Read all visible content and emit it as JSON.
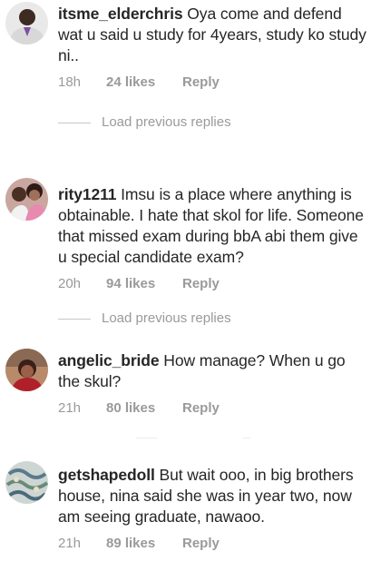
{
  "comments": [
    {
      "username": "itsme_elderchris",
      "text": "Oya come and defend wat u said u study for 4years, study ko study ni..",
      "time": "18h",
      "likes": "24 likes",
      "reply": "Reply"
    },
    {
      "username": "rity1211",
      "text": "Imsu is a place where  anything is obtainable. I hate that skol for life. Someone that missed exam during bbA abi them give u special candidate exam?",
      "time": "20h",
      "likes": "94 likes",
      "reply": "Reply"
    },
    {
      "username": "angelic_bride",
      "text": "How manage? When u go the skul?",
      "time": "21h",
      "likes": "80 likes",
      "reply": "Reply"
    },
    {
      "username": "getshapedoll",
      "text": "But wait ooo, in big brothers house,  nina said she was in year two,  now am seeing graduate, nawaoo.",
      "time": "21h",
      "likes": "89 likes",
      "reply": "Reply"
    }
  ],
  "load_replies": [
    {
      "label": "Load previous replies"
    },
    {
      "label": "Load previous replies"
    }
  ],
  "colors": {
    "text": "#262626",
    "meta": "#9a9a9a",
    "divider": "#c7c7c7"
  },
  "icons": [
    "avatar-elderchris",
    "avatar-rity1211",
    "avatar-angelic-bride",
    "avatar-getshapedoll"
  ]
}
